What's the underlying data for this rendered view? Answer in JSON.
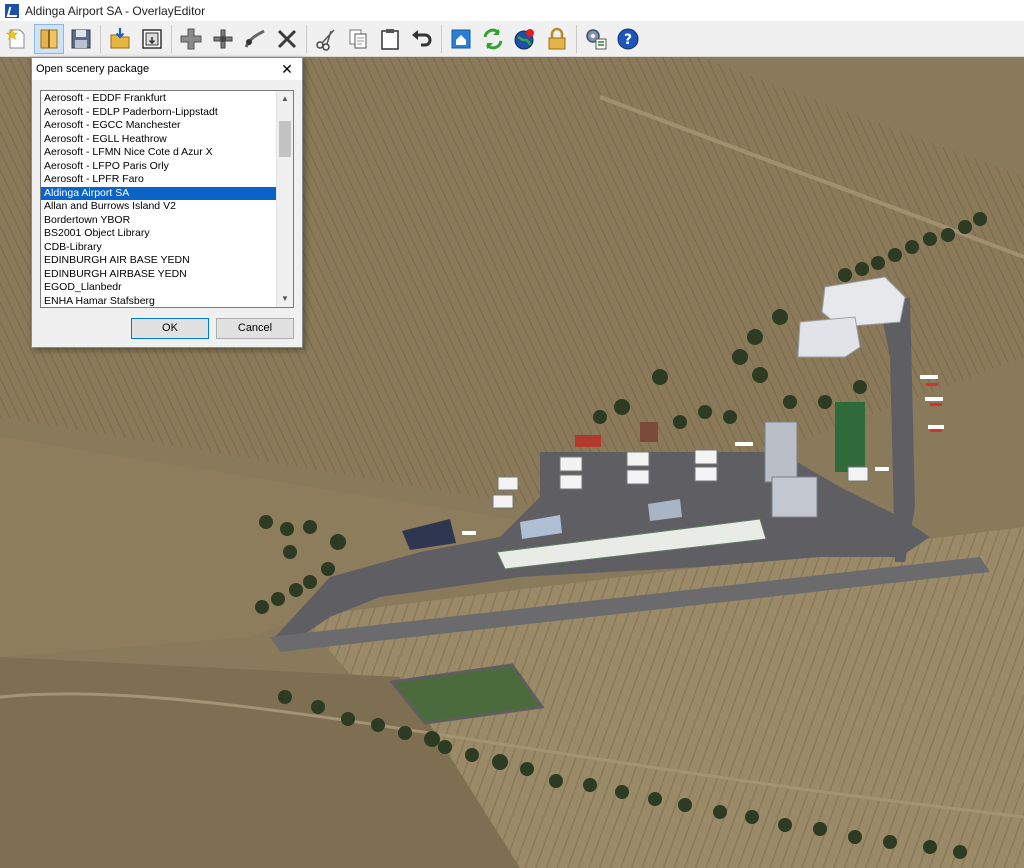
{
  "window": {
    "title": "Aldinga Airport SA - OverlayEditor"
  },
  "toolbar": {
    "buttons": [
      {
        "icon": "new-star-icon"
      },
      {
        "icon": "open-book-icon"
      },
      {
        "icon": "save-disk-icon"
      },
      {
        "icon": "import-folder-icon"
      },
      {
        "icon": "export-frame-icon"
      },
      {
        "icon": "add-plus-icon"
      },
      {
        "icon": "add-node-icon"
      },
      {
        "icon": "bezier-node-icon"
      },
      {
        "icon": "delete-x-icon"
      },
      {
        "icon": "cut-scissors-icon"
      },
      {
        "icon": "copy-icon"
      },
      {
        "icon": "paste-clipboard-icon"
      },
      {
        "icon": "undo-icon"
      },
      {
        "icon": "home-icon"
      },
      {
        "icon": "refresh-icon"
      },
      {
        "icon": "globe-icon"
      },
      {
        "icon": "lock-icon"
      },
      {
        "icon": "preferences-icon"
      },
      {
        "icon": "help-icon"
      }
    ]
  },
  "dialog": {
    "title": "Open scenery package",
    "close_label": "✕",
    "items": [
      "Aerosoft - EDDF Frankfurt",
      "Aerosoft - EDLP Paderborn-Lippstadt",
      "Aerosoft - EGCC Manchester",
      "Aerosoft - EGLL Heathrow",
      "Aerosoft - LFMN Nice Cote d Azur X",
      "Aerosoft - LFPO Paris Orly",
      "Aerosoft - LPFR Faro",
      "Aldinga Airport SA",
      "Allan and Burrows Island V2",
      "Bordertown YBOR",
      "BS2001 Object Library",
      "CDB-Library",
      "EDINBURGH AIR BASE YEDN",
      "EDINBURGH AIRBASE YEDN",
      "EGOD_Llanbedr",
      "ENHA Hamar Stafsberg"
    ],
    "selected_index": 7,
    "ok_label": "OK",
    "cancel_label": "Cancel"
  },
  "colors": {
    "selection": "#0a63c9",
    "terrain": "#8a7a5c",
    "apron": "#5f5f63"
  }
}
